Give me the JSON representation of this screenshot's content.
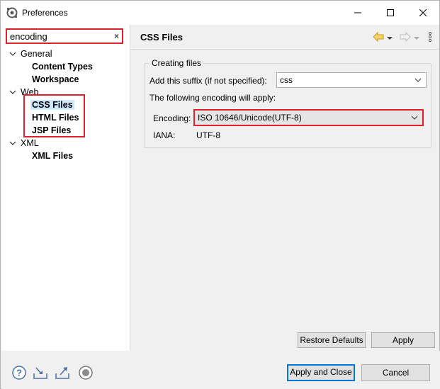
{
  "window": {
    "title": "Preferences",
    "icon": "eclipse-preferences-icon"
  },
  "filter": {
    "value": "encoding",
    "clear_icon": "×"
  },
  "tree": {
    "general": {
      "label": "General",
      "children": [
        "Content Types",
        "Workspace"
      ]
    },
    "web": {
      "label": "Web",
      "children": [
        "CSS Files",
        "HTML Files",
        "JSP Files"
      ]
    },
    "xml": {
      "label": "XML",
      "children": [
        "XML Files"
      ]
    },
    "selected": "CSS Files"
  },
  "page": {
    "title": "CSS Files",
    "group_title": "Creating files",
    "suffix_label": "Add this suffix (if not specified):",
    "suffix_value": "css",
    "encoding_info": "The following encoding will apply:",
    "encoding_label": "Encoding:",
    "encoding_value": "ISO 10646/Unicode(UTF-8)",
    "iana_label": "IANA:",
    "iana_value": "UTF-8"
  },
  "buttons": {
    "restore_defaults": "Restore Defaults",
    "apply": "Apply",
    "apply_and_close": "Apply and Close",
    "cancel": "Cancel"
  },
  "colors": {
    "highlight": "#e0202a",
    "selection": "#cde8ff",
    "default_button_border": "#0078d7"
  }
}
